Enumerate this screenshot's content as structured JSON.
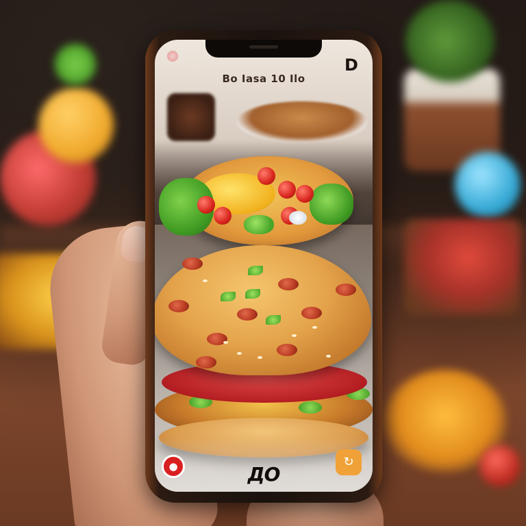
{
  "app": {
    "title": "Bo Iasa 10 Ilo",
    "corner_logo": "D",
    "brand_mark": "ДО"
  },
  "controls": {
    "left_button_icon": "record-icon",
    "left_button_glyph": "●",
    "right_button_icon": "refresh-icon",
    "right_button_glyph": "↻"
  },
  "colors": {
    "record_button": "#d92020",
    "action_button": "#f0a238"
  }
}
